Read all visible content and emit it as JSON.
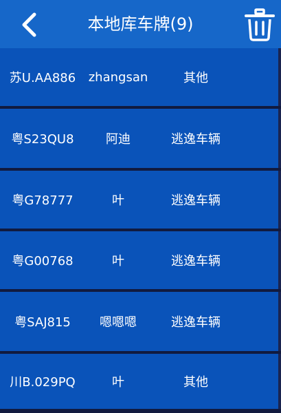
{
  "header": {
    "title": "本地库车牌(9)",
    "back_icon": "chevron-left-icon",
    "delete_icon": "trash-icon"
  },
  "colors": {
    "header_bg": "#1667c9",
    "row_bg": "#0a53b9",
    "separator": "#111a3f",
    "text": "#ffffff"
  },
  "rows": [
    {
      "plate": "苏U.AA886",
      "owner": "zhangsan",
      "type": "其他"
    },
    {
      "plate": "粤S23QU8",
      "owner": "阿迪",
      "type": "逃逸车辆"
    },
    {
      "plate": "粤G78777",
      "owner": "叶",
      "type": "逃逸车辆"
    },
    {
      "plate": "粤G00768",
      "owner": "叶",
      "type": "逃逸车辆"
    },
    {
      "plate": "粤SAJ815",
      "owner": "嗯嗯嗯",
      "type": "逃逸车辆"
    },
    {
      "plate": "川B.029PQ",
      "owner": "叶",
      "type": "其他"
    }
  ]
}
